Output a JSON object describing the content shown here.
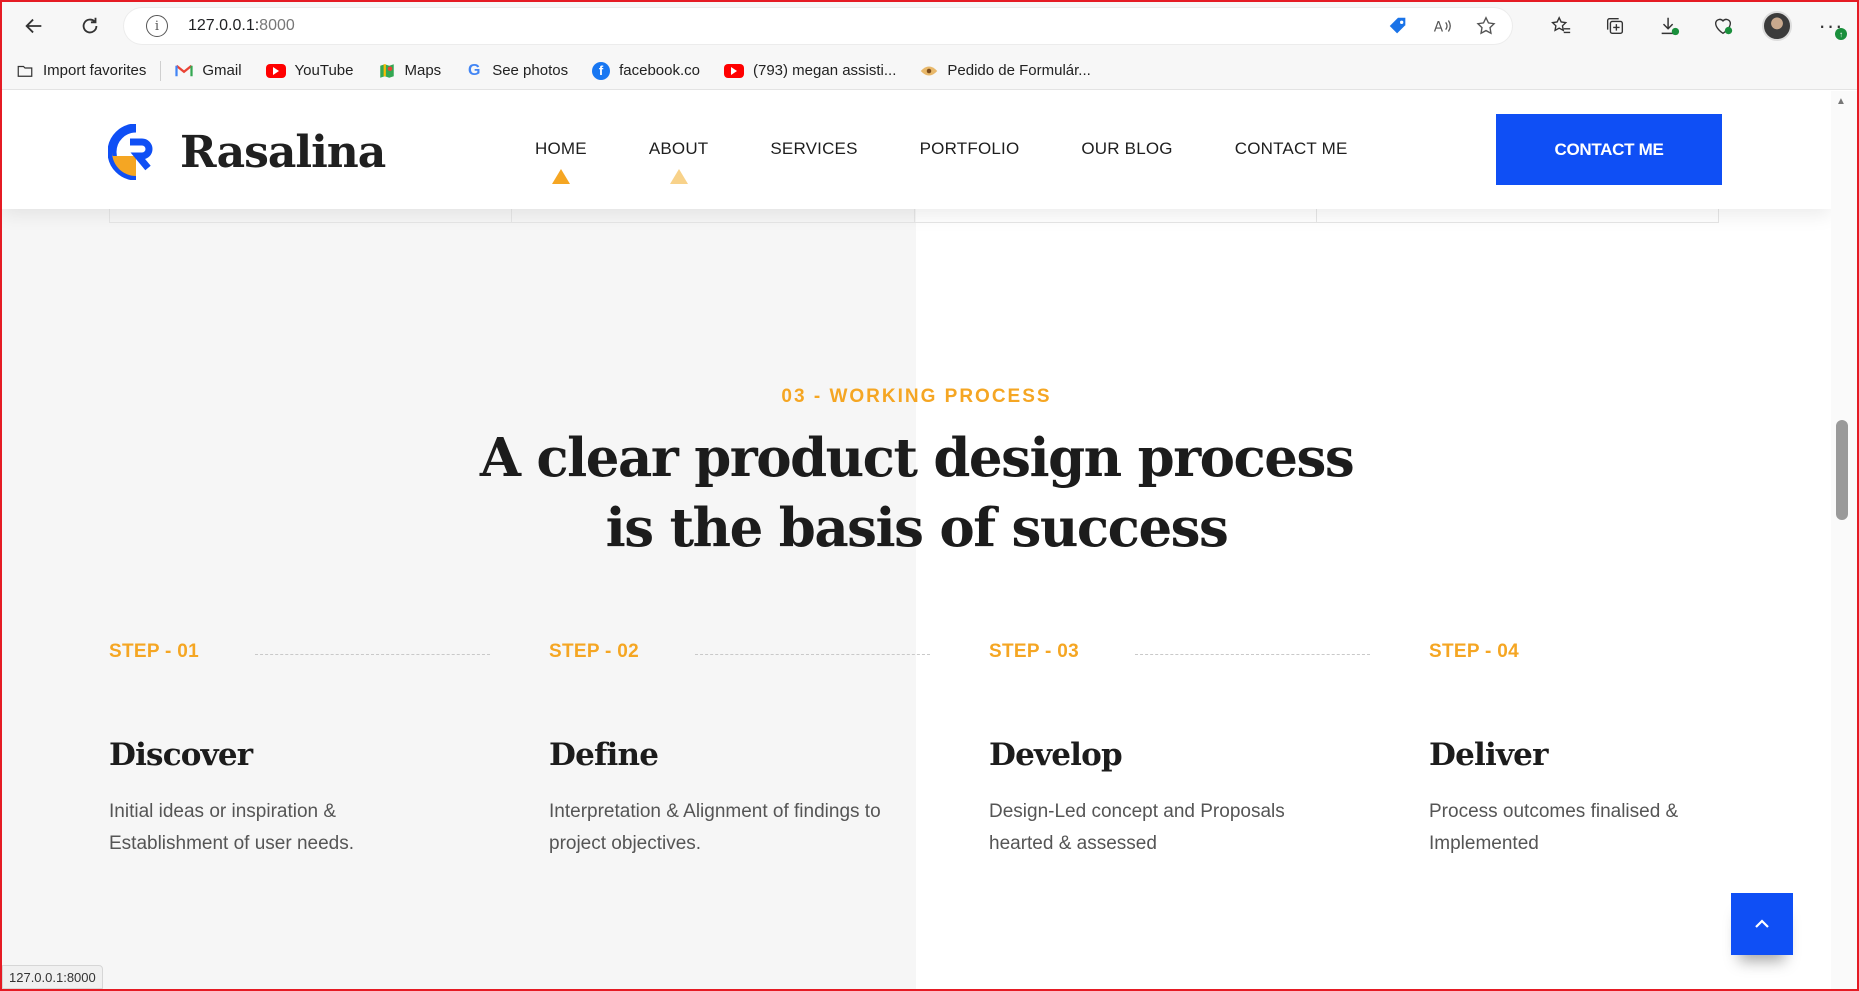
{
  "browser": {
    "url_host": "127.0.0.1:",
    "url_port": "8000",
    "status_url": "127.0.0.1:8000",
    "bookmarks": [
      {
        "label": "Import favorites",
        "icon": "folder-import-icon"
      },
      {
        "label": "Gmail",
        "icon": "gmail-icon"
      },
      {
        "label": "YouTube",
        "icon": "youtube-icon"
      },
      {
        "label": "Maps",
        "icon": "maps-icon"
      },
      {
        "label": "See photos",
        "icon": "google-icon"
      },
      {
        "label": "facebook.co",
        "icon": "facebook-icon"
      },
      {
        "label": "(793) megan assisti...",
        "icon": "youtube-icon"
      },
      {
        "label": "Pedido de Formulár...",
        "icon": "eye-icon"
      }
    ]
  },
  "site": {
    "logo_text": "Rasalina",
    "nav": [
      "HOME",
      "ABOUT",
      "SERVICES",
      "PORTFOLIO",
      "OUR BLOG",
      "CONTACT ME"
    ],
    "cta_label": "CONTACT ME"
  },
  "section": {
    "eyebrow": "03 - WORKING PROCESS",
    "headline_line1": "A clear product design process",
    "headline_line2": "is the basis of success",
    "steps": [
      {
        "label": "STEP - 01",
        "title": "Discover",
        "desc": "Initial ideas or inspiration & Establishment of user needs."
      },
      {
        "label": "STEP - 02",
        "title": "Define",
        "desc": "Interpretation & Alignment of findings to project objectives."
      },
      {
        "label": "STEP - 03",
        "title": "Develop",
        "desc": "Design-Led concept and Proposals hearted & assessed"
      },
      {
        "label": "STEP - 04",
        "title": "Deliver",
        "desc": "Process outcomes finalised & Implemented"
      }
    ]
  },
  "colors": {
    "accent": "#f5a623",
    "primary": "#0f4ff5",
    "frame": "#e51b24"
  }
}
